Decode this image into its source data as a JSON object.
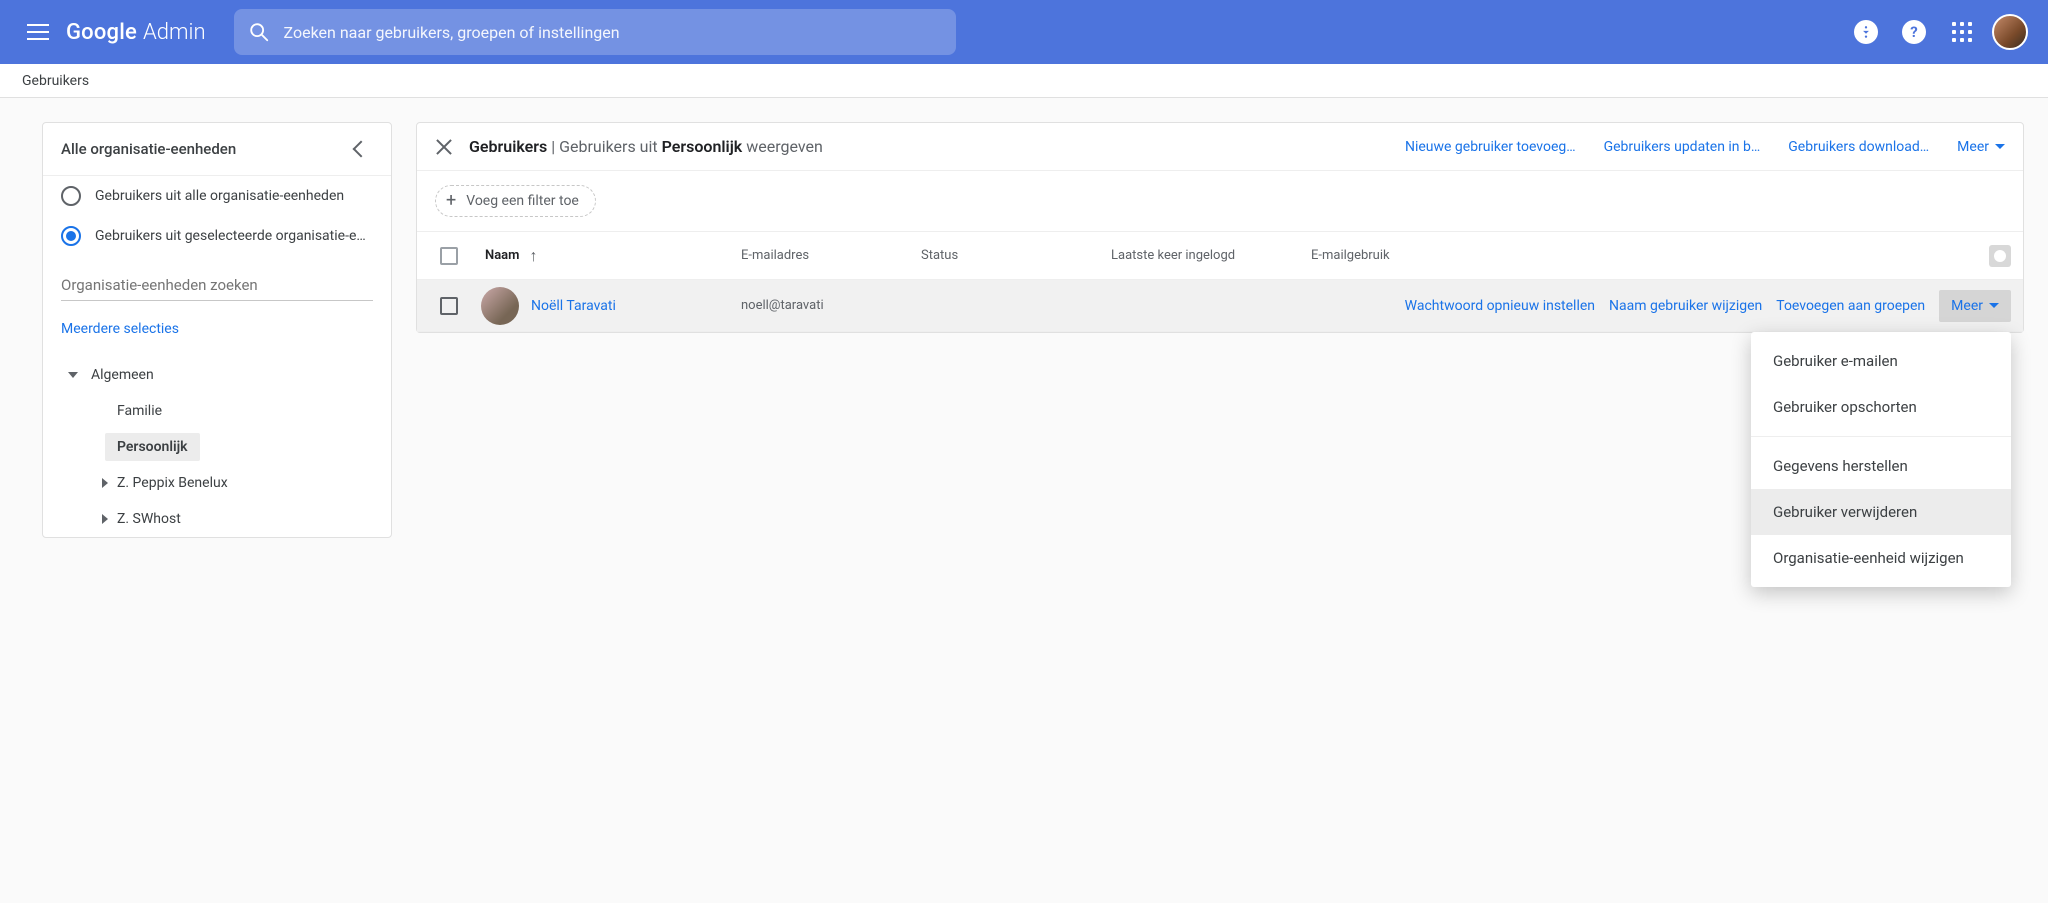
{
  "header": {
    "brand_google": "Google",
    "brand_admin": "Admin",
    "search_placeholder": "Zoeken naar gebruikers, groepen of instellingen"
  },
  "subnav": {
    "breadcrumb": "Gebruikers"
  },
  "sidebar": {
    "title": "Alle organisatie-eenheden",
    "radio_all": "Gebruikers uit alle organisatie-eenheden",
    "radio_selected": "Gebruikers uit geselecteerde organisatie-eenh…",
    "search_placeholder": "Organisatie-eenheden zoeken",
    "multi_select": "Meerdere selecties",
    "tree": {
      "root": "Algemeen",
      "items": [
        "Familie",
        "Persoonlijk",
        "Z. Peppix Benelux",
        "Z. SWhost"
      ],
      "active": "Persoonlijk"
    }
  },
  "content": {
    "breadcrumb": {
      "root": "Gebruikers",
      "sep": " | ",
      "prefix": "Gebruikers uit ",
      "target": "Persoonlijk",
      "suffix": " weergeven"
    },
    "header_actions": {
      "add_user": "Nieuwe gebruiker toevoeg…",
      "bulk_update": "Gebruikers updaten in b…",
      "download": "Gebruikers download…",
      "more": "Meer"
    },
    "filter_chip": "Voeg een filter toe",
    "columns": {
      "name": "Naam",
      "email": "E-mailadres",
      "status": "Status",
      "last_login": "Laatste keer ingelogd",
      "email_usage": "E-mailgebruik"
    },
    "user": {
      "name": "Noëll Taravati",
      "email": "noell@taravati",
      "actions": {
        "reset_pw": "Wachtwoord opnieuw instellen",
        "rename": "Naam gebruiker wijzigen",
        "add_groups": "Toevoegen aan groepen",
        "more": "Meer"
      }
    },
    "more_menu": {
      "email_user": "Gebruiker e-mailen",
      "suspend": "Gebruiker opschorten",
      "restore": "Gegevens herstellen",
      "delete": "Gebruiker verwijderen",
      "move_ou": "Organisatie-eenheid wijzigen"
    }
  }
}
